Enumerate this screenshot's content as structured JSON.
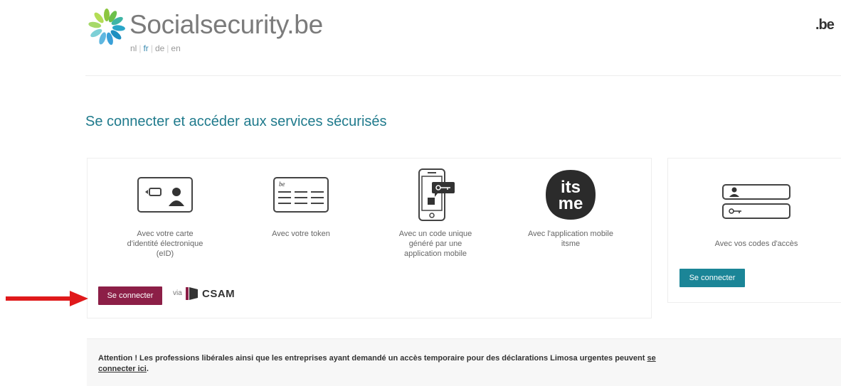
{
  "header": {
    "site_name": "Socialsecurity.be",
    "languages": [
      {
        "code": "nl",
        "active": false
      },
      {
        "code": "fr",
        "active": true
      },
      {
        "code": "de",
        "active": false
      },
      {
        "code": "en",
        "active": false
      }
    ],
    "be_mark": ".be"
  },
  "main": {
    "title": "Se connecter et accéder aux services sécurisés",
    "options": [
      {
        "icon": "eid-card-icon",
        "label_lines": [
          "Avec votre carte",
          "d'identité électronique",
          "(eID)"
        ]
      },
      {
        "icon": "token-card-icon",
        "label_lines": [
          "Avec votre token"
        ],
        "card_tag": "be"
      },
      {
        "icon": "mobile-code-icon",
        "label_lines": [
          "Avec un code unique",
          "généré par une",
          "application mobile"
        ]
      },
      {
        "icon": "itsme-logo-icon",
        "label_lines": [
          "Avec l'application mobile",
          "itsme"
        ],
        "logo_lines": [
          "its",
          "me"
        ]
      }
    ],
    "csam_button": "Se connecter",
    "via": "via",
    "csam_logo_text": "CSAM"
  },
  "side": {
    "icon": "access-codes-icon",
    "label": "Avec vos codes d'accès",
    "button": "Se connecter"
  },
  "notice": {
    "text": "Attention ! Les professions libérales ainsi que les entreprises ayant demandé un accès temporaire pour des déclarations Limosa urgentes peuvent ",
    "link_1": "se",
    "link_2": "connecter ici",
    "end": "."
  },
  "colors": {
    "title": "#1f7a8c",
    "csam_button": "#8c1f47",
    "codes_button": "#1b8597",
    "arrow": "#e0191b"
  }
}
